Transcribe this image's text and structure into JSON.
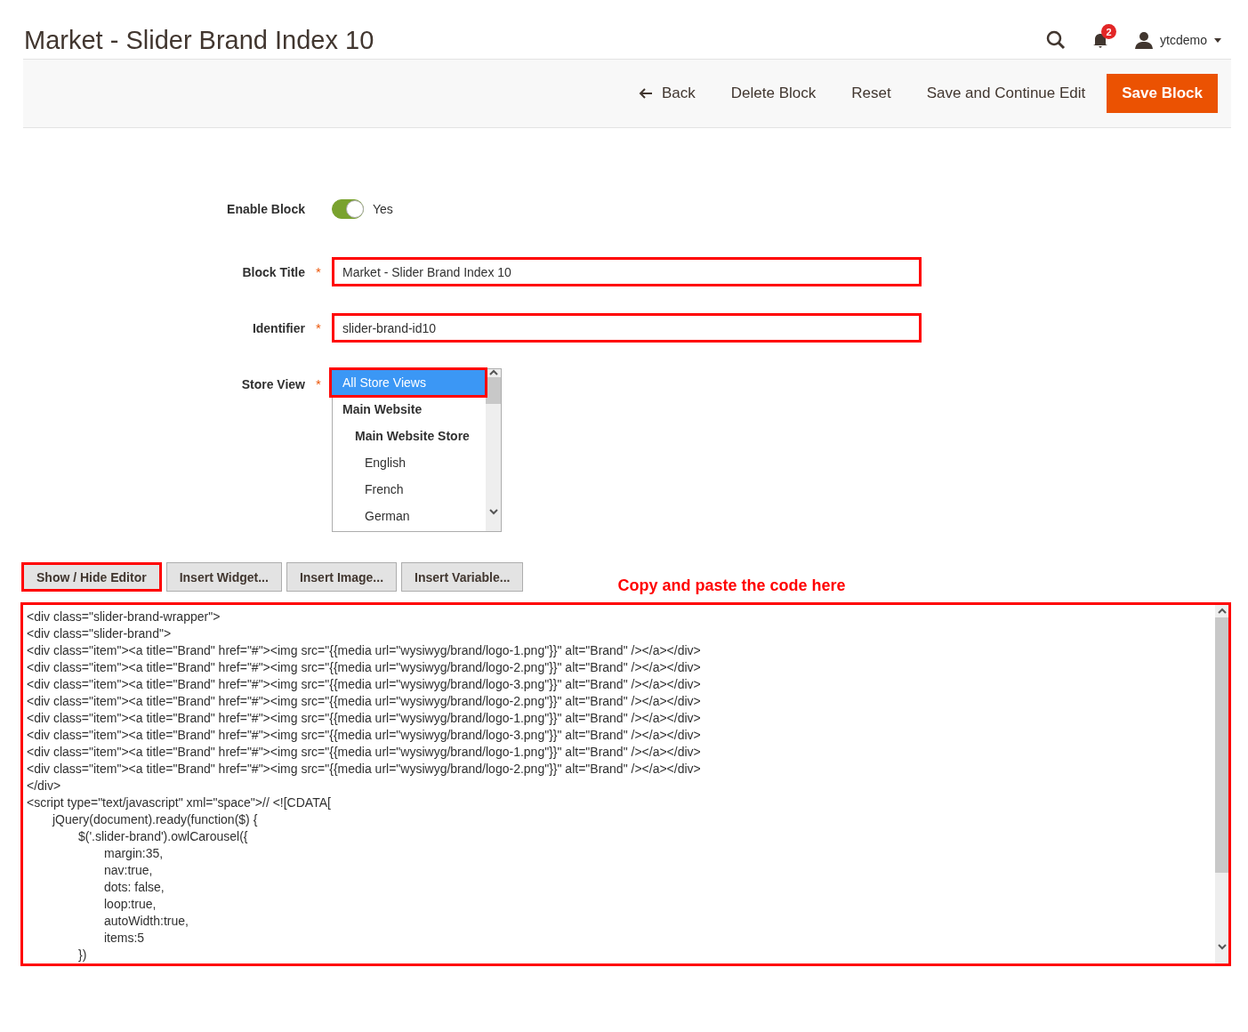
{
  "page": {
    "title": "Market - Slider Brand Index 10"
  },
  "header": {
    "notifications": {
      "count": "2"
    },
    "user": {
      "name": "ytcdemo"
    }
  },
  "toolbar": {
    "buttons": [
      {
        "label": "Back",
        "kind": "back"
      },
      {
        "label": "Delete Block",
        "kind": "plain"
      },
      {
        "label": "Reset",
        "kind": "plain"
      },
      {
        "label": "Save and Continue Edit",
        "kind": "plain"
      },
      {
        "label": "Save Block",
        "kind": "primary"
      }
    ]
  },
  "form": {
    "enable_block": {
      "label": "Enable Block",
      "on": true,
      "value_label": "Yes"
    },
    "block_title": {
      "label": "Block Title",
      "required_mark": "*",
      "value": "Market - Slider Brand Index 10"
    },
    "identifier": {
      "label": "Identifier",
      "required_mark": "*",
      "value": "slider-brand-id10"
    },
    "store_view": {
      "label": "Store View",
      "required_mark": "*",
      "options": [
        {
          "label": "All Store Views",
          "kind": "all",
          "selected": true
        },
        {
          "label": "Main Website",
          "kind": "website",
          "selected": false
        },
        {
          "label": "Main Website Store",
          "kind": "store",
          "selected": false
        },
        {
          "label": "English",
          "kind": "view",
          "selected": false
        },
        {
          "label": "French",
          "kind": "view",
          "selected": false
        },
        {
          "label": "German",
          "kind": "view",
          "selected": false
        }
      ]
    }
  },
  "editor": {
    "buttons": [
      {
        "label": "Show / Hide Editor",
        "highlighted": true
      },
      {
        "label": "Insert Widget...",
        "highlighted": false
      },
      {
        "label": "Insert Image...",
        "highlighted": false
      },
      {
        "label": "Insert Variable...",
        "highlighted": false
      }
    ],
    "annotation": "Copy and paste the code here",
    "code_lines": [
      "<div class=\"slider-brand-wrapper\">",
      "<div class=\"slider-brand\">",
      "<div class=\"item\"><a title=\"Brand\" href=\"#\"><img src=\"{{media url=\"wysiwyg/brand/logo-1.png\"}}\" alt=\"Brand\" /></a></div>",
      "<div class=\"item\"><a title=\"Brand\" href=\"#\"><img src=\"{{media url=\"wysiwyg/brand/logo-2.png\"}}\" alt=\"Brand\" /></a></div>",
      "<div class=\"item\"><a title=\"Brand\" href=\"#\"><img src=\"{{media url=\"wysiwyg/brand/logo-3.png\"}}\" alt=\"Brand\" /></a></div>",
      "<div class=\"item\"><a title=\"Brand\" href=\"#\"><img src=\"{{media url=\"wysiwyg/brand/logo-2.png\"}}\" alt=\"Brand\" /></a></div>",
      "<div class=\"item\"><a title=\"Brand\" href=\"#\"><img src=\"{{media url=\"wysiwyg/brand/logo-1.png\"}}\" alt=\"Brand\" /></a></div>",
      "<div class=\"item\"><a title=\"Brand\" href=\"#\"><img src=\"{{media url=\"wysiwyg/brand/logo-3.png\"}}\" alt=\"Brand\" /></a></div>",
      "<div class=\"item\"><a title=\"Brand\" href=\"#\"><img src=\"{{media url=\"wysiwyg/brand/logo-1.png\"}}\" alt=\"Brand\" /></a></div>",
      "<div class=\"item\"><a title=\"Brand\" href=\"#\"><img src=\"{{media url=\"wysiwyg/brand/logo-2.png\"}}\" alt=\"Brand\" /></a></div>",
      "</div>",
      "<script type=\"text/javascript\" xml=\"space\">// <![CDATA[",
      "\tjQuery(document).ready(function($) {",
      "\t\t$('.slider-brand').owlCarousel({",
      "\t\t\tmargin:35,",
      "\t\t\tnav:true,",
      "\t\t\tdots: false,",
      "\t\t\tloop:true,",
      "\t\t\tautoWidth:true,",
      "\t\t\titems:5",
      "\t\t})"
    ]
  }
}
